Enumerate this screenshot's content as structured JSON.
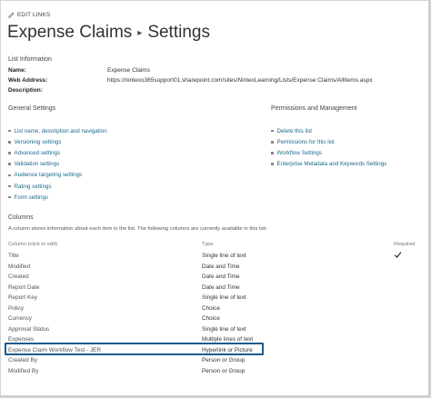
{
  "edit_links": "EDIT LINKS",
  "breadcrumb": {
    "list": "Expense Claims",
    "separator": "▸",
    "page": "Settings"
  },
  "list_info": {
    "heading": "List Information",
    "name_label": "Name:",
    "name_value": "Expense Claims",
    "address_label": "Web Address:",
    "address_value": "https://nintexo365support01.sharepoint.com/sites/NintexLearning/Lists/Expense Claims/AllItems.aspx",
    "description_label": "Description:",
    "description_value": ""
  },
  "general_settings": {
    "heading": "General Settings",
    "links": [
      "List name, description and navigation",
      "Versioning settings",
      "Advanced settings",
      "Validation settings",
      "Audience targeting settings",
      "Rating settings",
      "Form settings"
    ]
  },
  "permissions": {
    "heading": "Permissions and Management",
    "links": [
      "Delete this list",
      "Permissions for this list",
      "Workflow Settings",
      "Enterprise Metadata and Keywords Settings"
    ]
  },
  "columns": {
    "heading": "Columns",
    "description": "A column stores information about each item in the list. The following columns are currently available in this list:",
    "headers": {
      "column": "Column (click to edit)",
      "type": "Type",
      "required": "Required"
    },
    "rows": [
      {
        "name": "Title",
        "type": "Single line of text",
        "required": true
      },
      {
        "name": "Modified",
        "type": "Date and Time",
        "required": false
      },
      {
        "name": "Created",
        "type": "Date and Time",
        "required": false
      },
      {
        "name": "Report Date",
        "type": "Date and Time",
        "required": false
      },
      {
        "name": "Report Key",
        "type": "Single line of text",
        "required": false
      },
      {
        "name": "Policy",
        "type": "Choice",
        "required": false
      },
      {
        "name": "Currency",
        "type": "Choice",
        "required": false
      },
      {
        "name": "Approval Status",
        "type": "Single line of text",
        "required": false
      },
      {
        "name": "Expenses",
        "type": "Multiple lines of text",
        "required": false
      },
      {
        "name": "Expense Claim Workflow Test - JER",
        "type": "Hyperlink or Picture",
        "required": false
      },
      {
        "name": "Created By",
        "type": "Person or Group",
        "required": false
      },
      {
        "name": "Modified By",
        "type": "Person or Group",
        "required": false
      }
    ]
  },
  "highlighted_column": "Expenses",
  "colors": {
    "link": "#1a6a8f",
    "highlight_border": "#1c5a8e"
  }
}
